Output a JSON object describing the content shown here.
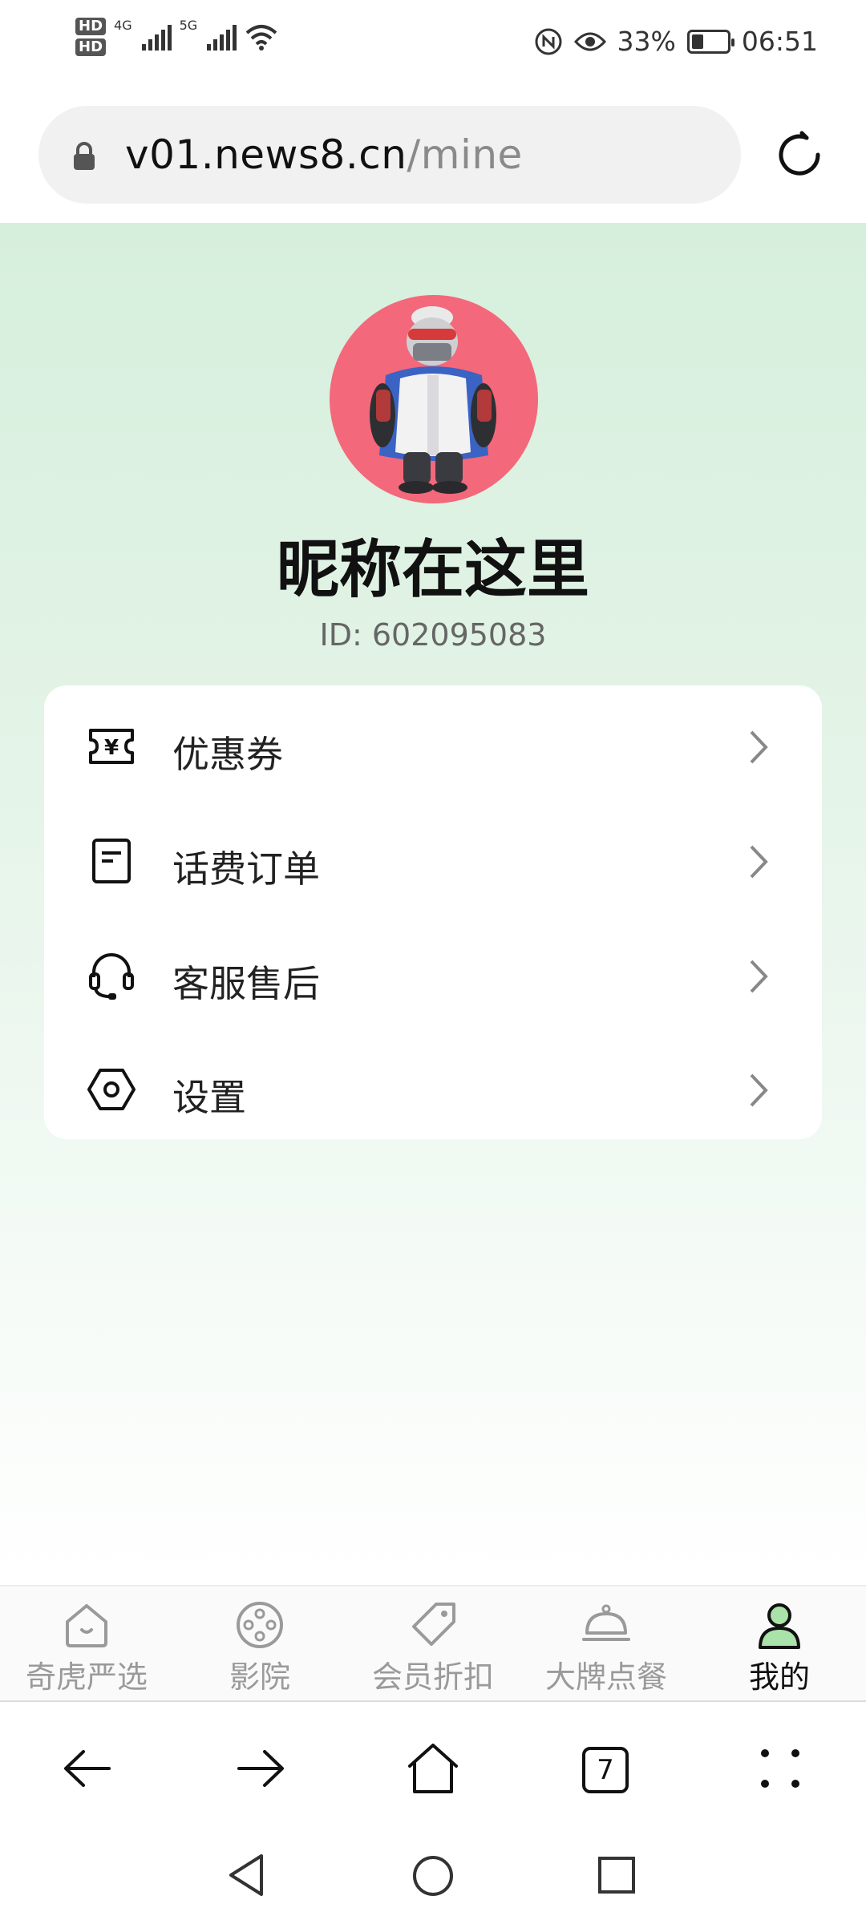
{
  "status_bar": {
    "hd1": "HD",
    "hd2": "HD",
    "net1": "4G",
    "net2": "5G",
    "battery_percent": "33%",
    "time": "06:51",
    "battery_level": 0.33
  },
  "browser": {
    "url_host": "v01.news8.cn",
    "url_path": "/mine"
  },
  "profile": {
    "nickname": "昵称在这里",
    "id_text": "ID: 602095083",
    "avatar_bg": "#f3687a"
  },
  "menu": {
    "items": [
      {
        "label": "优惠券",
        "icon": "coupon-icon"
      },
      {
        "label": "话费订单",
        "icon": "order-icon"
      },
      {
        "label": "客服售后",
        "icon": "headset-icon"
      },
      {
        "label": "设置",
        "icon": "settings-icon"
      }
    ]
  },
  "tab_bar": {
    "tabs": [
      {
        "label": "奇虎严选",
        "icon": "home-icon",
        "active": false
      },
      {
        "label": "影院",
        "icon": "film-reel-icon",
        "active": false
      },
      {
        "label": "会员折扣",
        "icon": "tag-icon",
        "active": false
      },
      {
        "label": "大牌点餐",
        "icon": "food-dome-icon",
        "active": false
      },
      {
        "label": "我的",
        "icon": "user-icon",
        "active": true
      }
    ],
    "active_color": "#a9e3a9"
  },
  "browser_nav": {
    "tab_count": "7"
  }
}
